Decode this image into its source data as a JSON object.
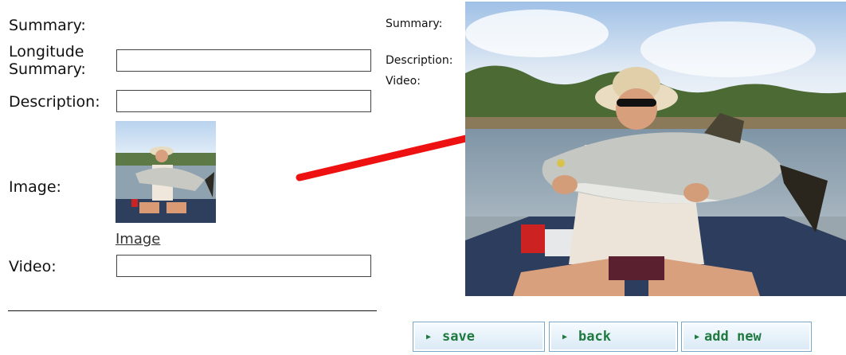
{
  "form": {
    "summary_label": "Summary:",
    "longitude_label_line1": "Longitude",
    "longitude_label_line2": "Summary:",
    "description_label": "Description:",
    "image_label": "Image:",
    "image_link": "Image",
    "video_label": "Video:",
    "longitude_value": "",
    "description_value": "",
    "video_value": ""
  },
  "preview": {
    "summary_label": "Summary:",
    "description_label": "Description:",
    "video_label": "Video:"
  },
  "buttons": {
    "save": "save",
    "back": "back",
    "add_new": "add new"
  },
  "colors": {
    "arrow": "#ee1111",
    "button_text": "#1f7a3f",
    "button_border": "#7aa8c8"
  },
  "icons": {
    "button_marker": "triangle-right-icon"
  }
}
